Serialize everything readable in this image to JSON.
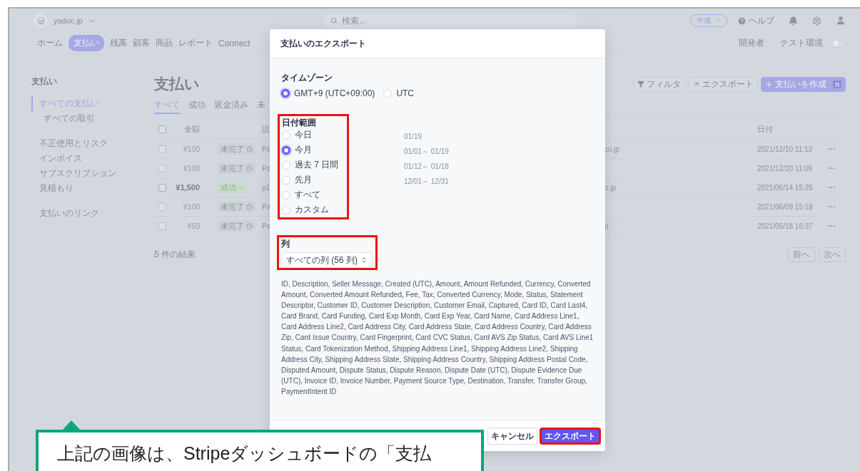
{
  "top_bar": {
    "account": "yadoc.jp",
    "search": {
      "placeholder": "検索..."
    },
    "create_button": "作成",
    "help": "ヘルプ"
  },
  "nav": {
    "items": [
      {
        "label": "ホーム",
        "selected": false
      },
      {
        "label": "支払い",
        "selected": true
      },
      {
        "label": "残高",
        "selected": false
      },
      {
        "label": "顧客",
        "selected": false
      },
      {
        "label": "商品",
        "selected": false
      },
      {
        "label": "レポート",
        "selected": false
      },
      {
        "label": "Connect",
        "selected": false
      }
    ],
    "developer": "開発者",
    "test_mode": {
      "label": "テスト環境",
      "on": false
    }
  },
  "sidebar": {
    "title": "支払い",
    "sections": [
      {
        "items": [
          {
            "label": "すべての支払い",
            "selected": true,
            "children": [
              {
                "label": "すべての取引",
                "selected": false
              }
            ]
          }
        ]
      },
      {
        "items": [
          {
            "label": "不正使用とリスク",
            "selected": false
          },
          {
            "label": "インボイス",
            "selected": false
          },
          {
            "label": "サブスクリプション",
            "selected": false
          },
          {
            "label": "見積もり",
            "selected": false
          }
        ]
      },
      {
        "items": [
          {
            "label": "支払いのリンク",
            "selected": false
          }
        ]
      }
    ]
  },
  "page": {
    "title": "支払い",
    "tabs": [
      {
        "label": "すべて",
        "selected": true
      },
      {
        "label": "成功",
        "selected": false
      },
      {
        "label": "返金済み",
        "selected": false
      },
      {
        "label": "未",
        "selected": false
      }
    ],
    "actions": [
      {
        "label": "フィルタ",
        "kind": "filter"
      },
      {
        "label": "エクスポート",
        "kind": "export"
      },
      {
        "label": "支払いを作成",
        "kind": "primary",
        "shortcut": "n"
      }
    ],
    "table": {
      "select_all": {
        "checked": false
      },
      "columns": {
        "amount": "金額",
        "description": "説",
        "date": "日付"
      },
      "rows": [
        {
          "checked": false,
          "amount": "¥100",
          "status": {
            "label": "未完了",
            "kind": "pending"
          },
          "description": "Pa",
          "column_4": "co.jp",
          "date": "2021/12/10 11:13"
        },
        {
          "checked": false,
          "amount": "¥100",
          "status": {
            "label": "未完了",
            "kind": "pending"
          },
          "description": "Pa",
          "date": "2021/12/10 11:09"
        },
        {
          "checked": false,
          "amount": "¥1,500",
          "status": {
            "label": "成功",
            "kind": "succeeded"
          },
          "description": "p1",
          "column_4": "o.jp",
          "date": "2021/06/14 15:25"
        },
        {
          "checked": false,
          "amount": "¥100",
          "status": {
            "label": "未完了",
            "kind": "pending"
          },
          "description": "Pa",
          "date": "2021/06/09 15:18"
        },
        {
          "checked": false,
          "amount": "¥50",
          "status": {
            "label": "未完了",
            "kind": "pending"
          },
          "description": "Pa",
          "column_4": "p",
          "date": "2021/05/18 16:37"
        }
      ]
    },
    "results": "5 件の結果",
    "pager": [
      "前へ",
      "次へ"
    ]
  },
  "modal": {
    "title": "支払いのエクスポート",
    "timezone": {
      "label": "タイムゾーン",
      "options": [
        {
          "label": "GMT+9 (UTC+09:00)",
          "selected": true
        },
        {
          "label": "UTC",
          "selected": false
        }
      ]
    },
    "date_range": {
      "label": "日付範囲",
      "highlighted": true,
      "options": [
        {
          "label": "今日",
          "range": "01/19",
          "selected": false
        },
        {
          "label": "今月",
          "range": "01/01～ 01/19",
          "selected": true
        },
        {
          "label": "過去 7 日間",
          "range": "01/12～ 01/18",
          "selected": false
        },
        {
          "label": "先月",
          "range": "12/01～ 12/31",
          "selected": false
        },
        {
          "label": "すべて",
          "selected": false
        },
        {
          "label": "カスタム",
          "selected": false
        }
      ]
    },
    "columns": {
      "label": "列",
      "highlighted": true,
      "value": "すべての列 (56 列)",
      "description": "ID, Description, Seller Message, Created (UTC), Amount, Amount Refunded, Currency, Converted Amount, Converted Amount Refunded, Fee, Tax, Converted Currency, Mode, Status, Statement Descriptor, Customer ID, Customer Description, Customer Email, Captured, Card ID, Card Last4, Card Brand, Card Funding, Card Exp Month, Card Exp Year, Card Name, Card Address Line1, Card Address Line2, Card Address City, Card Address State, Card Address Country, Card Address Zip, Card Issue Country, Card Fingerprint, Card CVC Status, Card AVS Zip Status, Card AVS Line1 Status, Card Tokenization Method, Shipping Address Line1, Shipping Address Line2, Shipping Address City, Shipping Address State, Shipping Address Country, Shipping Address Postal Code, Disputed Amount, Dispute Status, Dispute Reason, Dispute Date (UTC), Dispute Evidence Due (UTC), Invoice ID, Invoice Number, Payment Source Type, Destination, Transfer, Transfer Group, PaymentIntent ID"
    },
    "buttons": [
      {
        "label": "キャンセル",
        "kind": "secondary",
        "highlighted": false
      },
      {
        "label": "エクスポート",
        "kind": "primary",
        "highlighted": true
      }
    ]
  },
  "callout": {
    "text": "上記の画像は、Stripeダッシュボードの「支払"
  }
}
